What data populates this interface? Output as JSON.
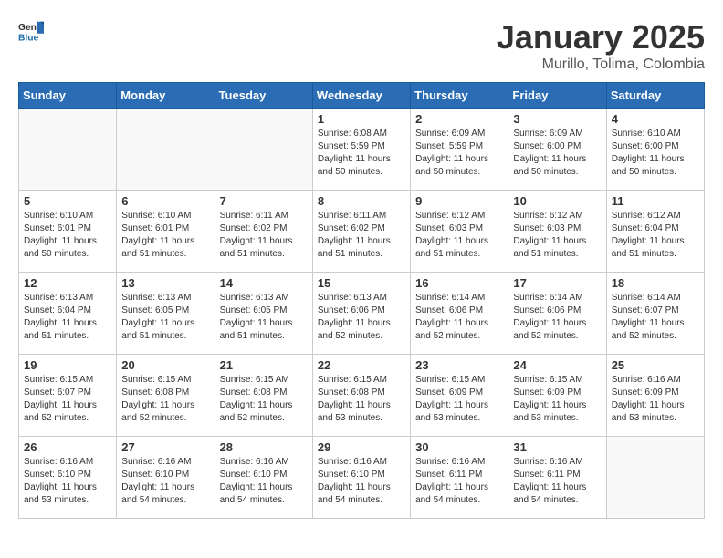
{
  "header": {
    "logo_general": "General",
    "logo_blue": "Blue",
    "title": "January 2025",
    "subtitle": "Murillo, Tolima, Colombia"
  },
  "weekdays": [
    "Sunday",
    "Monday",
    "Tuesday",
    "Wednesday",
    "Thursday",
    "Friday",
    "Saturday"
  ],
  "weeks": [
    [
      {
        "day": "",
        "info": ""
      },
      {
        "day": "",
        "info": ""
      },
      {
        "day": "",
        "info": ""
      },
      {
        "day": "1",
        "info": "Sunrise: 6:08 AM\nSunset: 5:59 PM\nDaylight: 11 hours\nand 50 minutes."
      },
      {
        "day": "2",
        "info": "Sunrise: 6:09 AM\nSunset: 5:59 PM\nDaylight: 11 hours\nand 50 minutes."
      },
      {
        "day": "3",
        "info": "Sunrise: 6:09 AM\nSunset: 6:00 PM\nDaylight: 11 hours\nand 50 minutes."
      },
      {
        "day": "4",
        "info": "Sunrise: 6:10 AM\nSunset: 6:00 PM\nDaylight: 11 hours\nand 50 minutes."
      }
    ],
    [
      {
        "day": "5",
        "info": "Sunrise: 6:10 AM\nSunset: 6:01 PM\nDaylight: 11 hours\nand 50 minutes."
      },
      {
        "day": "6",
        "info": "Sunrise: 6:10 AM\nSunset: 6:01 PM\nDaylight: 11 hours\nand 51 minutes."
      },
      {
        "day": "7",
        "info": "Sunrise: 6:11 AM\nSunset: 6:02 PM\nDaylight: 11 hours\nand 51 minutes."
      },
      {
        "day": "8",
        "info": "Sunrise: 6:11 AM\nSunset: 6:02 PM\nDaylight: 11 hours\nand 51 minutes."
      },
      {
        "day": "9",
        "info": "Sunrise: 6:12 AM\nSunset: 6:03 PM\nDaylight: 11 hours\nand 51 minutes."
      },
      {
        "day": "10",
        "info": "Sunrise: 6:12 AM\nSunset: 6:03 PM\nDaylight: 11 hours\nand 51 minutes."
      },
      {
        "day": "11",
        "info": "Sunrise: 6:12 AM\nSunset: 6:04 PM\nDaylight: 11 hours\nand 51 minutes."
      }
    ],
    [
      {
        "day": "12",
        "info": "Sunrise: 6:13 AM\nSunset: 6:04 PM\nDaylight: 11 hours\nand 51 minutes."
      },
      {
        "day": "13",
        "info": "Sunrise: 6:13 AM\nSunset: 6:05 PM\nDaylight: 11 hours\nand 51 minutes."
      },
      {
        "day": "14",
        "info": "Sunrise: 6:13 AM\nSunset: 6:05 PM\nDaylight: 11 hours\nand 51 minutes."
      },
      {
        "day": "15",
        "info": "Sunrise: 6:13 AM\nSunset: 6:06 PM\nDaylight: 11 hours\nand 52 minutes."
      },
      {
        "day": "16",
        "info": "Sunrise: 6:14 AM\nSunset: 6:06 PM\nDaylight: 11 hours\nand 52 minutes."
      },
      {
        "day": "17",
        "info": "Sunrise: 6:14 AM\nSunset: 6:06 PM\nDaylight: 11 hours\nand 52 minutes."
      },
      {
        "day": "18",
        "info": "Sunrise: 6:14 AM\nSunset: 6:07 PM\nDaylight: 11 hours\nand 52 minutes."
      }
    ],
    [
      {
        "day": "19",
        "info": "Sunrise: 6:15 AM\nSunset: 6:07 PM\nDaylight: 11 hours\nand 52 minutes."
      },
      {
        "day": "20",
        "info": "Sunrise: 6:15 AM\nSunset: 6:08 PM\nDaylight: 11 hours\nand 52 minutes."
      },
      {
        "day": "21",
        "info": "Sunrise: 6:15 AM\nSunset: 6:08 PM\nDaylight: 11 hours\nand 52 minutes."
      },
      {
        "day": "22",
        "info": "Sunrise: 6:15 AM\nSunset: 6:08 PM\nDaylight: 11 hours\nand 53 minutes."
      },
      {
        "day": "23",
        "info": "Sunrise: 6:15 AM\nSunset: 6:09 PM\nDaylight: 11 hours\nand 53 minutes."
      },
      {
        "day": "24",
        "info": "Sunrise: 6:15 AM\nSunset: 6:09 PM\nDaylight: 11 hours\nand 53 minutes."
      },
      {
        "day": "25",
        "info": "Sunrise: 6:16 AM\nSunset: 6:09 PM\nDaylight: 11 hours\nand 53 minutes."
      }
    ],
    [
      {
        "day": "26",
        "info": "Sunrise: 6:16 AM\nSunset: 6:10 PM\nDaylight: 11 hours\nand 53 minutes."
      },
      {
        "day": "27",
        "info": "Sunrise: 6:16 AM\nSunset: 6:10 PM\nDaylight: 11 hours\nand 54 minutes."
      },
      {
        "day": "28",
        "info": "Sunrise: 6:16 AM\nSunset: 6:10 PM\nDaylight: 11 hours\nand 54 minutes."
      },
      {
        "day": "29",
        "info": "Sunrise: 6:16 AM\nSunset: 6:10 PM\nDaylight: 11 hours\nand 54 minutes."
      },
      {
        "day": "30",
        "info": "Sunrise: 6:16 AM\nSunset: 6:11 PM\nDaylight: 11 hours\nand 54 minutes."
      },
      {
        "day": "31",
        "info": "Sunrise: 6:16 AM\nSunset: 6:11 PM\nDaylight: 11 hours\nand 54 minutes."
      },
      {
        "day": "",
        "info": ""
      }
    ]
  ]
}
